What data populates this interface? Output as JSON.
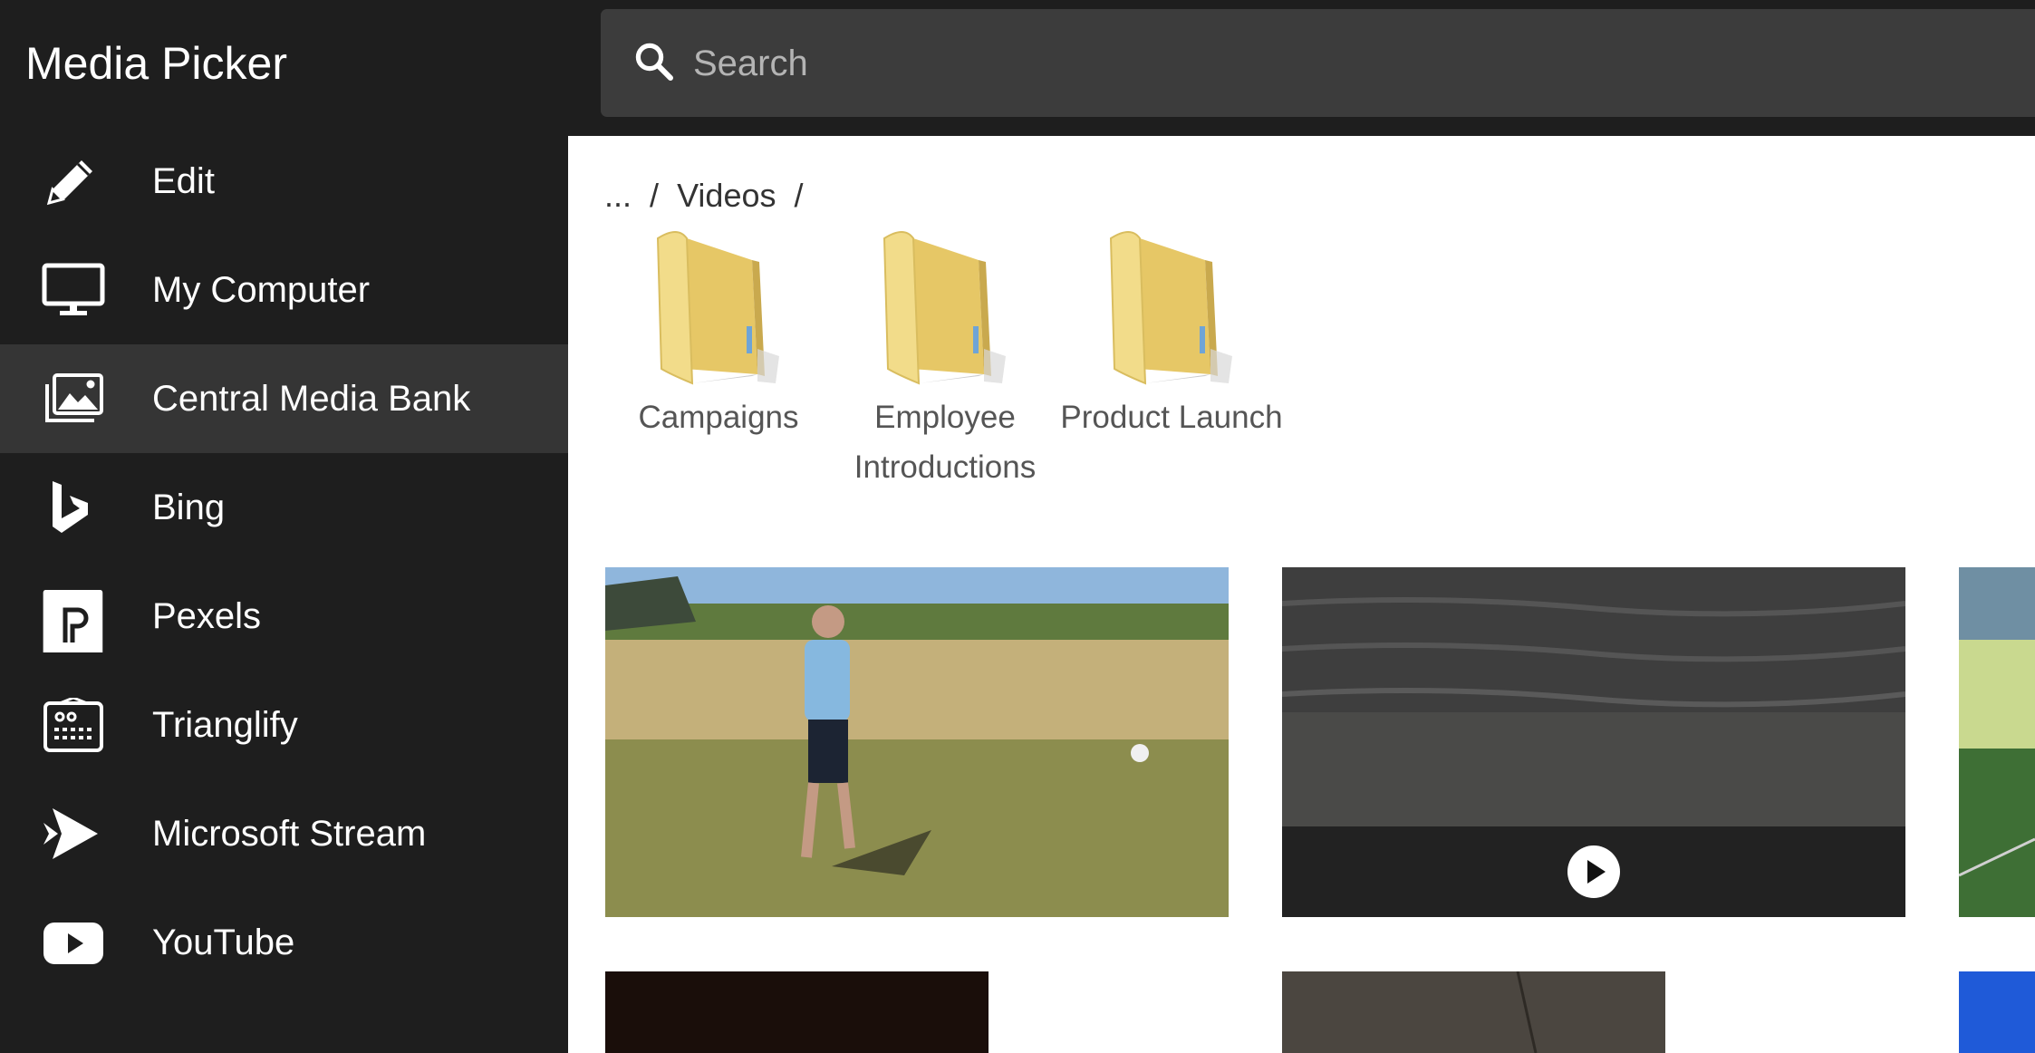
{
  "app": {
    "title": "Media Picker"
  },
  "search": {
    "placeholder": "Search",
    "icon": "search-icon"
  },
  "sidebar": {
    "selected": "Central Media Bank",
    "items": [
      {
        "label": "Edit",
        "icon": "pencil-icon"
      },
      {
        "label": "My Computer",
        "icon": "monitor-icon"
      },
      {
        "label": "Central Media Bank",
        "icon": "image-stack-icon"
      },
      {
        "label": "Bing",
        "icon": "bing-icon"
      },
      {
        "label": "Pexels",
        "icon": "pexels-icon"
      },
      {
        "label": "Trianglify",
        "icon": "trianglify-icon"
      },
      {
        "label": "Microsoft Stream",
        "icon": "stream-icon"
      },
      {
        "label": "YouTube",
        "icon": "youtube-icon"
      }
    ]
  },
  "breadcrumb": {
    "ellipsis": "...",
    "separator": "/",
    "current": "Videos"
  },
  "folders": [
    {
      "label": "Campaigns",
      "icon": "folder-icon"
    },
    {
      "label": "Employee Introductions",
      "icon": "folder-icon"
    },
    {
      "label": "Product Launch",
      "icon": "folder-icon"
    }
  ],
  "colors": {
    "sidebar_bg": "#1e1e1e",
    "sidebar_selected": "#353535",
    "search_bg": "#3c3c3c",
    "content_bg": "#ffffff",
    "folder_yellow": "#f3dc8c"
  }
}
